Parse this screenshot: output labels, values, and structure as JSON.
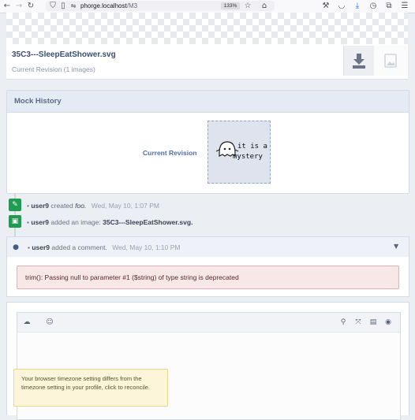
{
  "browser": {
    "url_host": "phorge.localhost",
    "url_path": "/M3",
    "zoom": "133%"
  },
  "file": {
    "name": "35C3---SleepEatShower.svg",
    "subtitle": "Current Revision (1 images)"
  },
  "mock_history": {
    "title": "Mock History",
    "current_revision_label": "Current Revision",
    "thumb_line1": "it is a",
    "thumb_line2": "mystery"
  },
  "timeline": [
    {
      "user": "user9",
      "action": "created",
      "object": "foo.",
      "date": "Wed, May 10, 1:07 PM"
    },
    {
      "user": "user9",
      "action": "added an image:",
      "object": "35C3---SleepEatShower.svg."
    },
    {
      "user": "user9",
      "action": "added a comment.",
      "date": "Wed, May 10, 1:10 PM"
    }
  ],
  "comment": {
    "error": "trim(): Passing null to parameter #1 ($string) of type string is deprecated"
  },
  "timezone_notice": "Your browser timezone setting differs from the timezone setting in your profile, click to reconcile.",
  "colors": {
    "accent_blue": "#4e6fa8",
    "green_icon": "#1e9c4f",
    "comment_icon": "#4a5d80",
    "error_bg": "#f8e7e7",
    "notice_bg": "#fdf5d9"
  }
}
